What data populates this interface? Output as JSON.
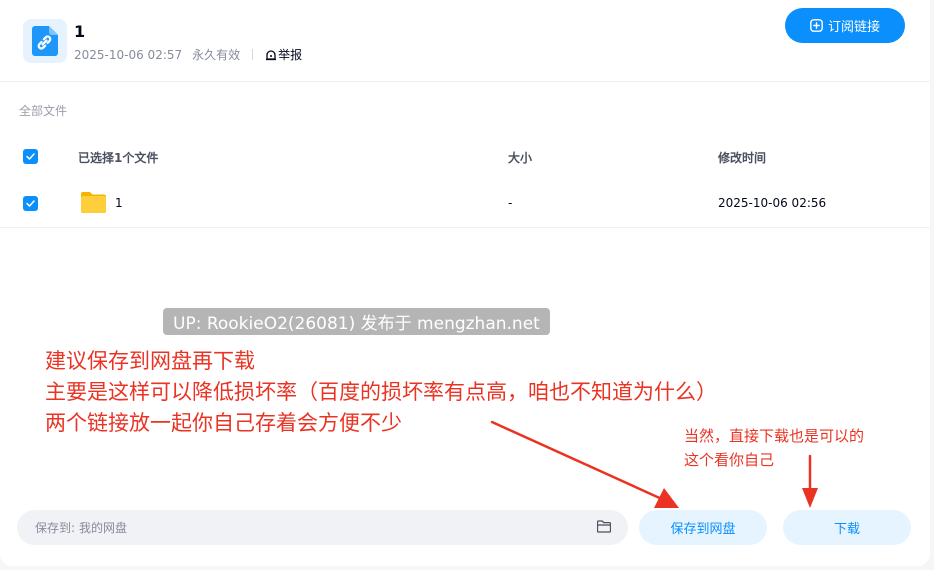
{
  "share": {
    "title": "1",
    "date": "2025-10-06 02:57",
    "validity": "永久有效",
    "report_label": "举报",
    "subscribe_label": "订阅链接"
  },
  "breadcrumb": "全部文件",
  "table": {
    "headers": {
      "name": "已选择1个文件",
      "size": "大小",
      "modified": "修改时间"
    },
    "rows": [
      {
        "name": "1",
        "size": "-",
        "modified": "2025-10-06 02:56",
        "checked": true
      }
    ]
  },
  "watermark": "UP: RookieO2(26081) 发布于 mengzhan.net",
  "annotation": {
    "lines": [
      "建议保存到网盘再下载",
      "主要是这样可以降低损坏率（百度的损坏率有点高，咱也不知道为什么）",
      "两个链接放一起你自己存着会方便不少"
    ],
    "side_lines": [
      "当然，直接下载也是可以的",
      "这个看你自己"
    ],
    "color": "#ea3323"
  },
  "footer": {
    "save_to_label": "保存到:",
    "save_to_value": "我的网盘",
    "save_button": "保存到网盘",
    "download_button": "下载"
  },
  "colors": {
    "accent": "#0a8ffc",
    "light_button": "#e6f4ff"
  },
  "icons": [
    "link-file-icon",
    "report-icon",
    "subscribe-plus-icon",
    "checkbox-checked-icon",
    "folder-icon",
    "choose-folder-icon"
  ]
}
